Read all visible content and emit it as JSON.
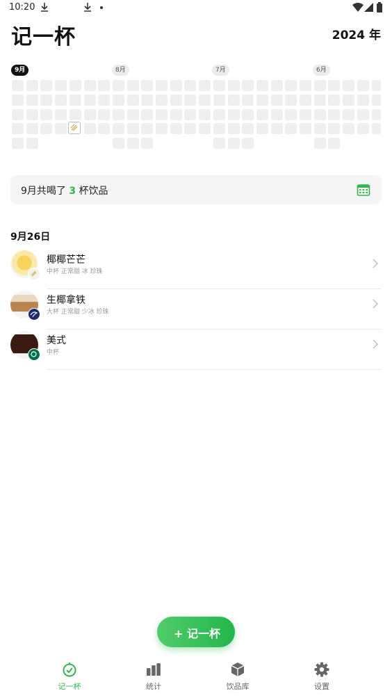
{
  "status_bar": {
    "time": "10:20"
  },
  "header": {
    "app_title": "记一杯",
    "year": "2024 年"
  },
  "heatmap": {
    "months": [
      {
        "label": "9月",
        "active": true
      },
      {
        "label": "8月",
        "active": false
      },
      {
        "label": "7月",
        "active": false
      },
      {
        "label": "6月",
        "active": false
      }
    ]
  },
  "summary": {
    "prefix": "9月共喝了 ",
    "count": "3",
    "suffix": " 杯饮品"
  },
  "day": {
    "date": "9月26日",
    "drinks": [
      {
        "name": "椰椰芒芒",
        "options": "中杯 正常甜 冰 珍珠",
        "brand_icon": "brand-badge-icon",
        "accent": "#f3c63b"
      },
      {
        "name": "生椰拿铁",
        "options": "大杯 正常甜 少冰 珍珠",
        "brand_icon": "luckin-logo-icon",
        "accent": "#1d2a6b"
      },
      {
        "name": "美式",
        "options": "中杯",
        "brand_icon": "starbucks-logo-icon",
        "accent": "#00704a"
      }
    ]
  },
  "fab": {
    "label": "+ 记一杯"
  },
  "tabs": [
    {
      "label": "记一杯",
      "icon": "cup-record-icon",
      "active": true
    },
    {
      "label": "统计",
      "icon": "bar-chart-icon",
      "active": false
    },
    {
      "label": "饮品库",
      "icon": "box-icon",
      "active": false
    },
    {
      "label": "设置",
      "icon": "gear-icon",
      "active": false
    }
  ],
  "colors": {
    "accent": "#2db84d",
    "cell": "#efefef",
    "summary_bg": "#f5f5f5"
  }
}
